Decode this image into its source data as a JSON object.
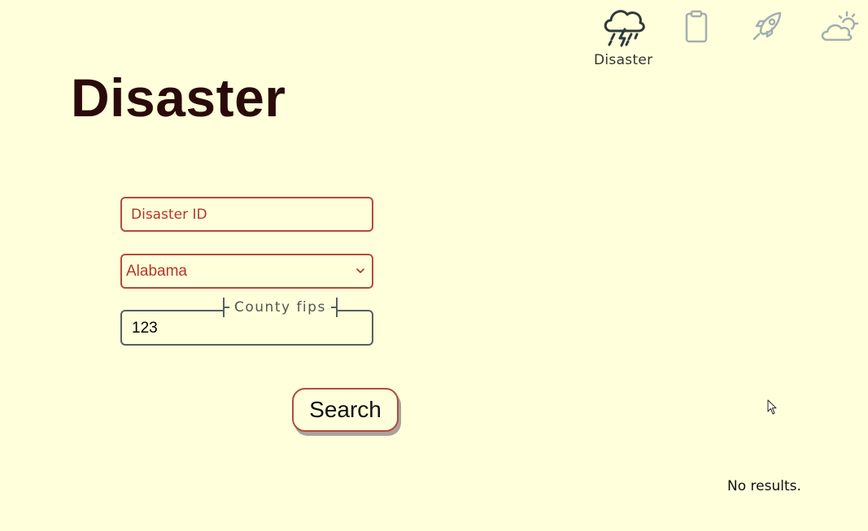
{
  "nav": {
    "items": [
      {
        "label": "Disaster",
        "icon": "thunderstorm-icon"
      },
      {
        "label": "",
        "icon": "clipboard-icon"
      },
      {
        "label": "",
        "icon": "rocket-icon"
      },
      {
        "label": "",
        "icon": "partly-cloudy-icon"
      }
    ]
  },
  "page": {
    "title": "Disaster"
  },
  "form": {
    "disaster_id_placeholder": "Disaster ID",
    "state_selected": "Alabama",
    "county_fips_label": "County fips",
    "county_fips_value": "123",
    "search_label": "Search"
  },
  "results": {
    "message": "No results."
  },
  "colors": {
    "background": "#ffffdb",
    "accent_border": "#b74a3c",
    "accent_text": "#b3362a",
    "title": "#2b0a0a"
  }
}
